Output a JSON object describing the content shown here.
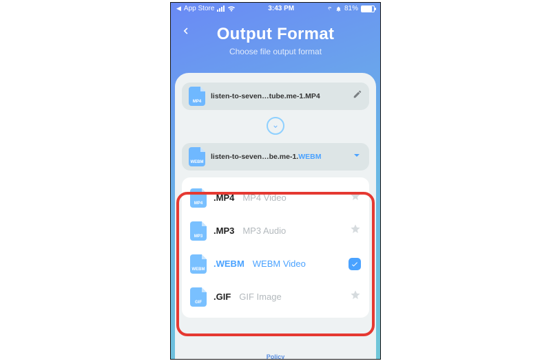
{
  "status": {
    "back_app": "App Store",
    "time": "3:43 PM",
    "battery_text": "81%"
  },
  "header": {
    "title": "Output Format",
    "subtitle": "Choose file output format"
  },
  "source": {
    "icon_label": "MP4",
    "filename": "listen-to-seven…tube.me-1.MP4"
  },
  "target": {
    "icon_label": "WEBM",
    "filename_base": "listen-to-seven…be.me-1.",
    "filename_ext": "WEBM"
  },
  "formats": [
    {
      "icon": "MP4",
      "ext": ".MP4",
      "desc": "MP4 Video",
      "selected": false
    },
    {
      "icon": "MP3",
      "ext": ".MP3",
      "desc": "MP3 Audio",
      "selected": false
    },
    {
      "icon": "WEBM",
      "ext": ".WEBM",
      "desc": "WEBM Video",
      "selected": true
    },
    {
      "icon": "GIF",
      "ext": ".GIF",
      "desc": "GIF Image",
      "selected": false
    }
  ],
  "footer": {
    "policy": "Policy"
  }
}
